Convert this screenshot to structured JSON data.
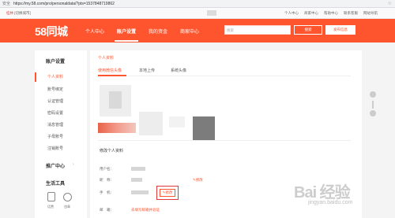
{
  "browser": {
    "secure_label": "安全",
    "url": "https://my.58.com/pro/personaldata/?pts=1537848719862"
  },
  "top_strip": {
    "city": "桂林",
    "switch_city": "[切换城市]",
    "links": [
      "个人中心",
      "商家中心",
      "帮助中心",
      "联系客服",
      "网站导航"
    ]
  },
  "header": {
    "logo": "58同城",
    "nav": [
      "个人中心",
      "账户设置",
      "我的资金",
      "商家中心"
    ],
    "search_placeholder": "搜索",
    "search_button": "搜索",
    "post_button": "发布信息"
  },
  "sidebar": {
    "account_title": "账户设置",
    "account_items": [
      "个人资料",
      "账号绑定",
      "认证管理",
      "密码设置",
      "消息管理",
      "子母账号",
      "注销账号"
    ],
    "promo_title": "推广中心",
    "tools_title": "生活工具",
    "tools": [
      "话费",
      "违章"
    ]
  },
  "main": {
    "breadcrumb": "个人资料",
    "tabs": [
      "使用微信头像",
      "本地上传",
      "系统头像"
    ],
    "edit_title": "修改个人资料",
    "fields": {
      "username_label": "用户名：",
      "nickname_label": "昵　称：",
      "phone_label": "手　机：",
      "email_label": "邮　箱："
    },
    "nickname_edit": "修改",
    "phone_edit": "修改",
    "email_action": "去填写邮箱并验证"
  },
  "watermark": {
    "text": "Bai 经验",
    "sub": "jingyan.baidu.com"
  }
}
